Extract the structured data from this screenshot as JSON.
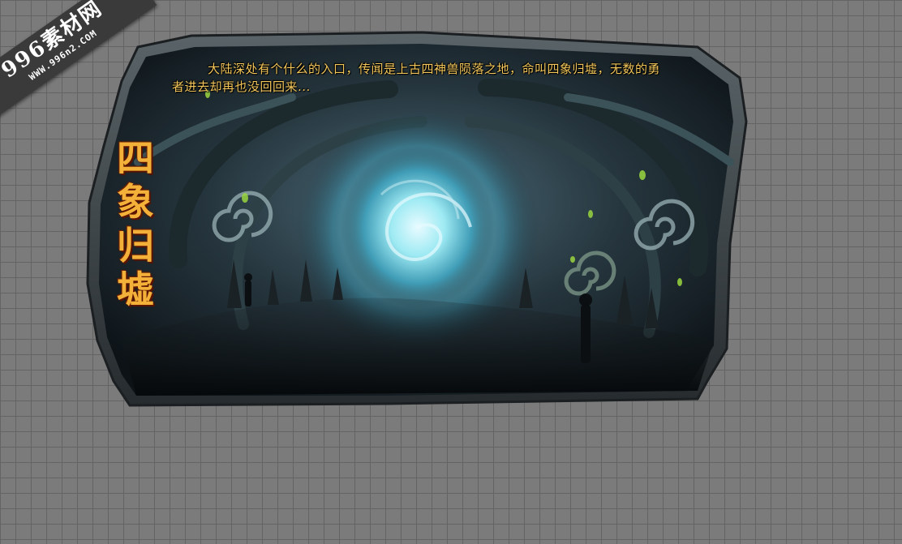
{
  "watermark": {
    "main": "996素材网",
    "sub": "WWW.996n2.COM"
  },
  "scene": {
    "title_chars": [
      "四",
      "象",
      "归",
      "墟"
    ],
    "description": "大陆深处有个什么的入口，传闻是上古四神兽陨落之地，命叫四象归墟，无数的勇者进去却再也没回回来..."
  },
  "colors": {
    "background": "#7b7b7b",
    "grid": "#646464",
    "title": "#f4b13a",
    "description": "#f2c65a",
    "portal": "#7fe6f2"
  }
}
